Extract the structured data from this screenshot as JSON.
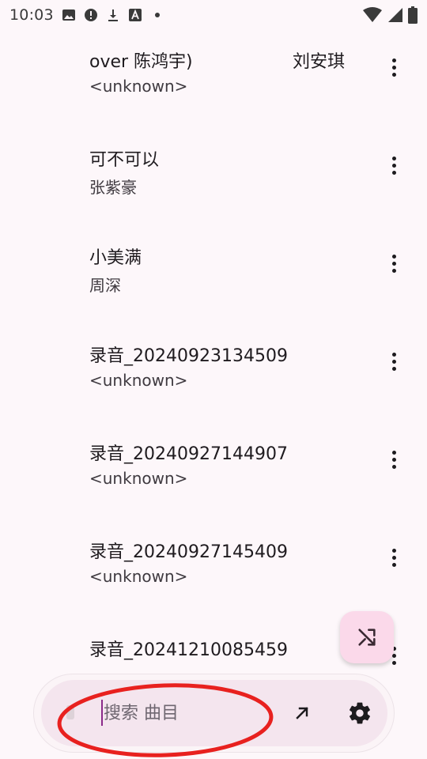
{
  "status_bar": {
    "time": "10:03",
    "left_icons": [
      "image-icon",
      "alert-icon",
      "download-icon",
      "translate-icon",
      "dot-icon"
    ],
    "right_icons": [
      "wifi-icon",
      "signal-icon",
      "battery-icon"
    ]
  },
  "songs": [
    {
      "title": "over 陈鸿宇)",
      "extra": "刘安琪",
      "artist": "<unknown>"
    },
    {
      "title": "可不可以",
      "artist": "张紫豪"
    },
    {
      "title": "小美满",
      "artist": "周深"
    },
    {
      "title": "录音_20240923134509",
      "artist": "<unknown>"
    },
    {
      "title": "录音_20240927144907",
      "artist": "<unknown>"
    },
    {
      "title": "录音_20240927145409",
      "artist": "<unknown>"
    },
    {
      "title": "录音_20241210085459",
      "artist": ""
    }
  ],
  "fab": {
    "icon": "shuffle-icon"
  },
  "search": {
    "placeholder": "搜索 曲目",
    "value": "",
    "arrow_icon": "arrow-up-right-icon",
    "settings_icon": "gear-icon"
  },
  "colors": {
    "background": "#fdf7fa",
    "fab": "#fbd9ea",
    "search_bar": "#f4e5ee",
    "cursor": "#8b2a8a",
    "annotation": "#e8211f"
  }
}
